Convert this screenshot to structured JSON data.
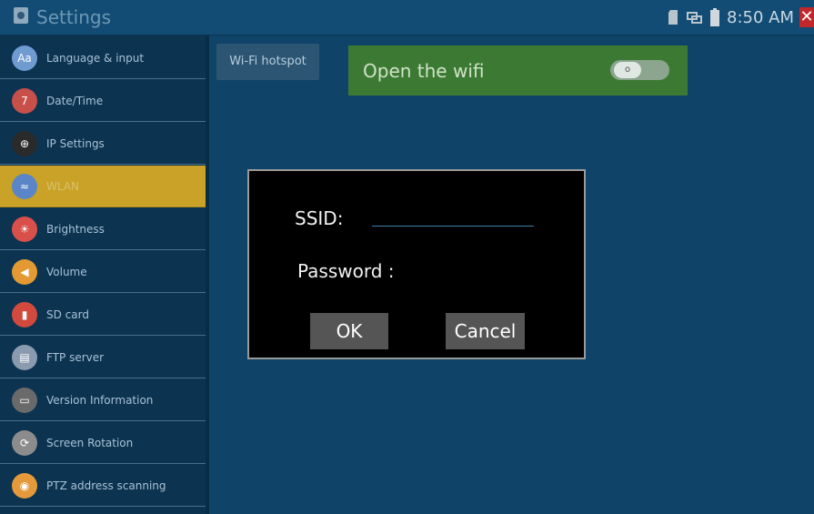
{
  "header": {
    "title": "Settings",
    "time": "8:50 AM",
    "close_glyph": "✕"
  },
  "status_icons": [
    "sd-card-icon",
    "network-icon",
    "battery-icon"
  ],
  "sidebar": {
    "items": [
      {
        "label": "Language & input",
        "icon": "language-icon",
        "glyph": "Aa",
        "color": "#6f9bd0"
      },
      {
        "label": "Date/Time",
        "icon": "calendar-icon",
        "glyph": "7",
        "color": "#c7504a"
      },
      {
        "label": "IP Settings",
        "icon": "globe-icon",
        "glyph": "⊕",
        "color": "#2a2a2a"
      },
      {
        "label": "WLAN",
        "icon": "wifi-icon",
        "glyph": "≈",
        "color": "#5a86c8",
        "selected": true
      },
      {
        "label": "Brightness",
        "icon": "sun-icon",
        "glyph": "☀",
        "color": "#d9504a"
      },
      {
        "label": "Volume",
        "icon": "speaker-icon",
        "glyph": "◀",
        "color": "#e39a33"
      },
      {
        "label": "SD card",
        "icon": "sd-card-icon",
        "glyph": "▮",
        "color": "#d24a3e"
      },
      {
        "label": "FTP server",
        "icon": "server-icon",
        "glyph": "▤",
        "color": "#8a9bb0"
      },
      {
        "label": "Version Information",
        "icon": "monitor-icon",
        "glyph": "▭",
        "color": "#6a6a6a"
      },
      {
        "label": "Screen Rotation",
        "icon": "rotate-icon",
        "glyph": "⟳",
        "color": "#8c8c8c"
      },
      {
        "label": "PTZ address scanning",
        "icon": "ptz-icon",
        "glyph": "◉",
        "color": "#e49a3a"
      }
    ]
  },
  "main": {
    "tab_label": "Wi-Fi hotspot",
    "wifi_label": "Open the wifi",
    "toggle_state": "off",
    "toggle_glyph": "o"
  },
  "dialog": {
    "ssid_label": "SSID:",
    "ssid_value": "",
    "password_label": "Password :",
    "ok_label": "OK",
    "cancel_label": "Cancel"
  },
  "colors": {
    "background": "#0f4468",
    "selected": "#c9a227",
    "wifi_panel": "#3c7a33",
    "close": "#c0282b"
  }
}
